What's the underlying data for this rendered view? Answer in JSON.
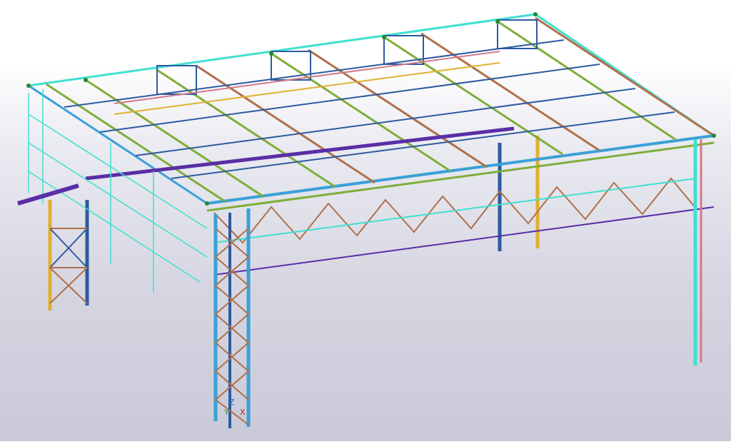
{
  "app": {
    "view_type": "3d-model-viewport",
    "background_colors": [
      "#ffffff",
      "#d6d6e2",
      "#c9c9d8"
    ]
  },
  "model": {
    "description_icon": "steel-structure-model",
    "member_colors": {
      "beam_blue": "#3aa0d8",
      "beam_cyan": "#40e0d0",
      "truss_green": "#7fae3a",
      "brace_brown": "#b0704a",
      "column_navy": "#2d5aa0",
      "column_yellow": "#e0b030",
      "purlin_purple": "#5a2ea6",
      "rail_pink": "#d07a8a",
      "node_green": "#1f8a2a"
    }
  },
  "axes": {
    "z_label": "Z",
    "x_label": "X",
    "y_label": "Y"
  }
}
